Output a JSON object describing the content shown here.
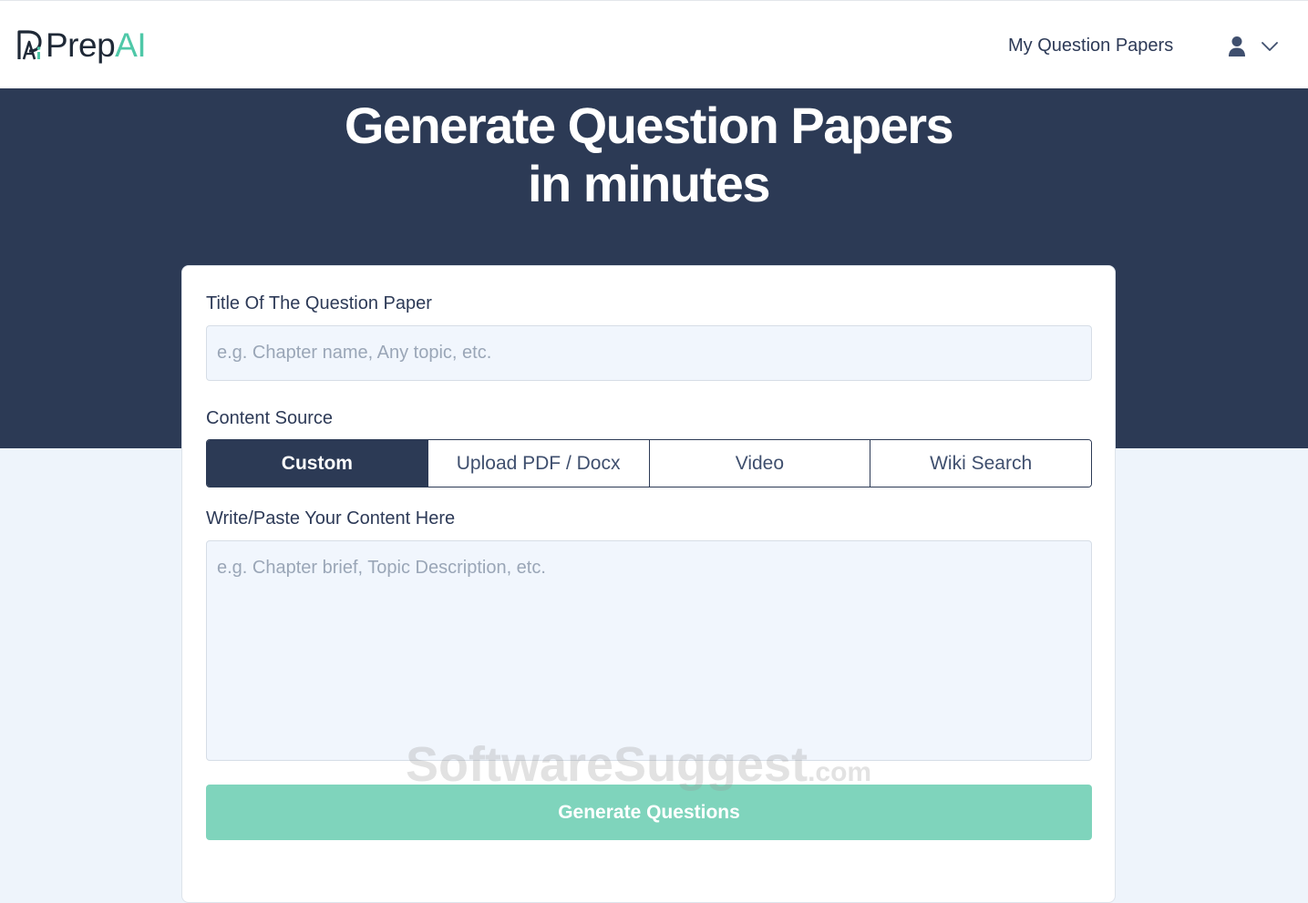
{
  "header": {
    "logo_prep": "Prep",
    "logo_ai": "AI",
    "nav_link": "My Question Papers",
    "user_icon": "user-icon",
    "dropdown_icon": "chevron-down-icon"
  },
  "hero": {
    "title_line1": "Generate Question Papers",
    "title_line2": "in minutes"
  },
  "form": {
    "title_label": "Title Of The Question Paper",
    "title_placeholder": "e.g. Chapter name, Any topic, etc.",
    "title_value": "",
    "source_label": "Content Source",
    "tabs": [
      {
        "label": "Custom",
        "active": true
      },
      {
        "label": "Upload PDF / Docx",
        "active": false
      },
      {
        "label": "Video",
        "active": false
      },
      {
        "label": "Wiki Search",
        "active": false
      }
    ],
    "content_label": "Write/Paste Your Content Here",
    "content_placeholder": "e.g. Chapter brief, Topic Description, etc.",
    "content_value": "",
    "submit_label": "Generate Questions"
  },
  "watermark": {
    "main": "SoftwareSuggest",
    "suffix": ".com"
  },
  "colors": {
    "primary_dark": "#2c3a55",
    "accent_green": "#7fd4bc",
    "logo_green": "#4fc8a8",
    "input_bg": "#f1f6fd"
  }
}
